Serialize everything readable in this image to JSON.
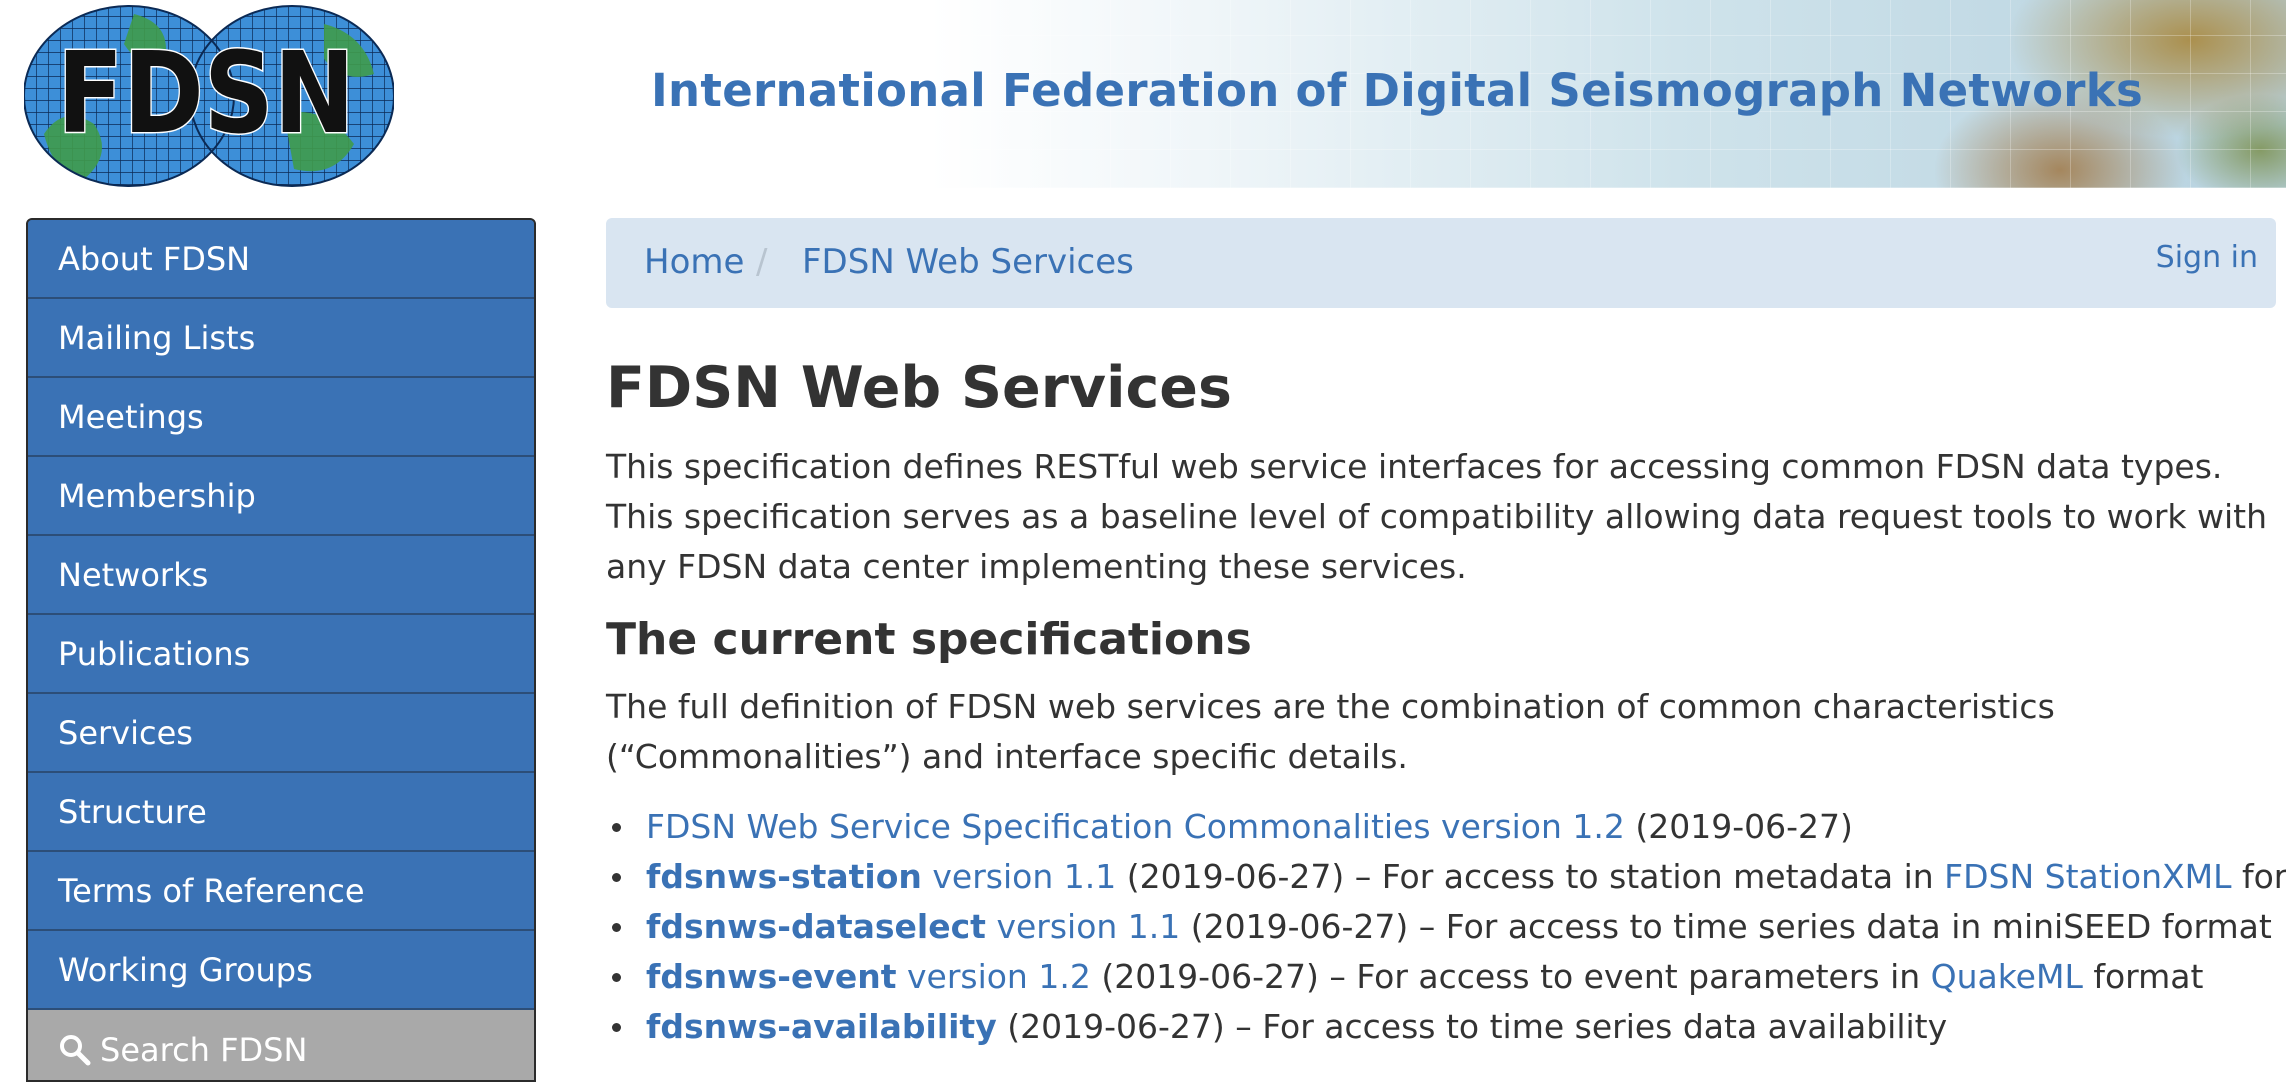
{
  "header": {
    "logo_text": "FDSN",
    "site_title": "International Federation of Digital Seismograph Networks"
  },
  "sidebar": {
    "items": [
      {
        "label": "About FDSN"
      },
      {
        "label": "Mailing Lists"
      },
      {
        "label": "Meetings"
      },
      {
        "label": "Membership"
      },
      {
        "label": "Networks"
      },
      {
        "label": "Publications"
      },
      {
        "label": "Services"
      },
      {
        "label": "Structure"
      },
      {
        "label": "Terms of Reference"
      },
      {
        "label": "Working Groups"
      }
    ],
    "search_label": "Search FDSN"
  },
  "breadcrumb": {
    "home": "Home",
    "separator": "/",
    "current": "FDSN Web Services",
    "sign_in": "Sign in"
  },
  "main": {
    "title": "FDSN Web Services",
    "intro": "This specification defines RESTful web service interfaces for accessing common FDSN data types. This specification serves as a baseline level of compatibility allowing data request tools to work with any FDSN data center implementing these services.",
    "section_title": "The current specifications",
    "section_text": "The full definition of FDSN web services are the combination of common characteristics (“Commonalities”) and interface specific details.",
    "specs": [
      {
        "link": "FDSN Web Service Specification Commonalities version 1.2",
        "date": " (2019-06-27)"
      },
      {
        "name": "fdsnws-station",
        "version": "version 1.1",
        "text": " (2019-06-27) – For access to station metadata in ",
        "format_link": "FDSN StationXML",
        "suffix": " format"
      },
      {
        "name": "fdsnws-dataselect",
        "version": "version 1.1",
        "text": " (2019-06-27) – For access to time series data in miniSEED format"
      },
      {
        "name": "fdsnws-event",
        "version": "version 1.2",
        "text": " (2019-06-27) – For access to event parameters in ",
        "format_link": "QuakeML",
        "suffix": " format"
      },
      {
        "name": "fdsnws-availability",
        "text": " (2019-06-27) – For access to time series data availability"
      }
    ]
  },
  "colors": {
    "brand_blue": "#3a72b5",
    "breadcrumb_bg": "#d9e5f1",
    "search_bg": "#a9a9a9",
    "text": "#333333"
  },
  "icons": {
    "search": "search-icon",
    "logo": "fdsn-globe-logo"
  }
}
